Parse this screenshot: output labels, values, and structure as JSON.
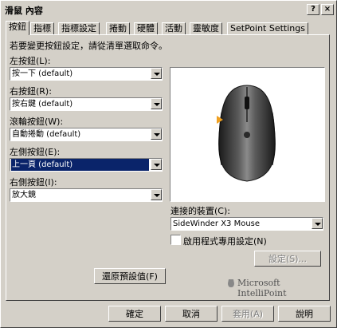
{
  "window": {
    "title": "滑鼠 內容",
    "help_glyph": "?",
    "close_glyph": "×"
  },
  "tabs": [
    {
      "label": "按鈕",
      "active": true
    },
    {
      "label": "指標"
    },
    {
      "label": "指標設定"
    },
    {
      "label": "捲動"
    },
    {
      "label": "硬體"
    },
    {
      "label": "活動"
    },
    {
      "label": "靈敏度"
    },
    {
      "label": "SetPoint Settings"
    }
  ],
  "panel": {
    "instruction": "若要變更按鈕設定，請從清單選取命令。",
    "buttons_config": [
      {
        "label": "左按鈕(L):",
        "value": "按一下 (default)"
      },
      {
        "label": "右按鈕(R):",
        "value": "按右鍵 (default)"
      },
      {
        "label": "滾輪按鈕(W):",
        "value": "自動捲動 (default)"
      },
      {
        "label": "左側按鈕(E):",
        "value": "上一頁 (default)",
        "selected": true
      },
      {
        "label": "右側按鈕(I):",
        "value": "放大鏡"
      }
    ],
    "device_label": "連接的裝置(C):",
    "device_value": "SideWinder X3 Mouse",
    "app_specific_label": "啟用程式專用設定(N)",
    "app_specific_checked": false,
    "settings_button": "設定(S)...",
    "restore_button": "還原預設值(F)",
    "brand": "Microsoft IntelliPoint"
  },
  "footer": {
    "ok": "確定",
    "cancel": "取消",
    "apply": "套用(A)",
    "help": "說明"
  },
  "colors": {
    "face": "#d4d0c8",
    "selection": "#0a246a",
    "mouse_arrow": "#f0a020"
  }
}
